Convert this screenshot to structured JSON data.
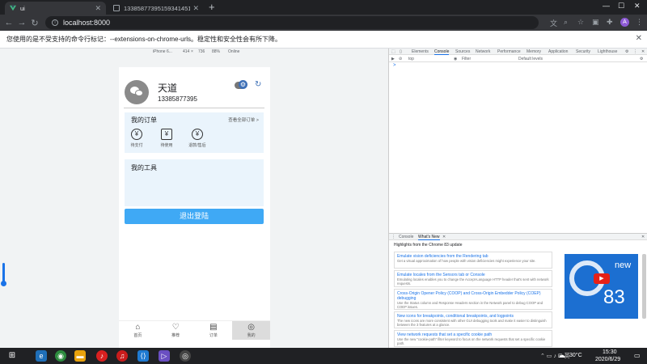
{
  "browser": {
    "tabs": [
      {
        "title": "ui",
        "active": true
      },
      {
        "title": "13385877395159341451856...",
        "active": false
      }
    ],
    "new_tab": "+",
    "url": "localhost:8000",
    "profile_initial": "A",
    "infobar_text": "您使用的是不受支持的命令行标记：--extensions-on-chrome-urls。稳定性和安全性会有所下降。"
  },
  "device_toolbar": {
    "device": "iPhone 6...",
    "width": "414",
    "height": "736",
    "zoom": "88%",
    "network": "Online"
  },
  "app": {
    "user": {
      "name": "天道",
      "phone": "13385877395"
    },
    "orders": {
      "title": "我的订单",
      "view_all": "查看全部订单 >",
      "items": [
        {
          "label": "待支付",
          "icon": "yen-icon"
        },
        {
          "label": "待使用",
          "icon": "ticket-icon"
        },
        {
          "label": "退款/售后",
          "icon": "refund-icon"
        }
      ]
    },
    "tools": {
      "title": "我的工具"
    },
    "logout_label": "退出登陆",
    "tabbar": [
      {
        "label": "首页",
        "icon": "home-icon"
      },
      {
        "label": "推荐",
        "icon": "heart-icon"
      },
      {
        "label": "订单",
        "icon": "list-icon"
      },
      {
        "label": "我的",
        "icon": "user-icon"
      }
    ]
  },
  "devtools": {
    "tabs": [
      "Elements",
      "Console",
      "Sources",
      "Network",
      "Performance",
      "Memory",
      "Application",
      "Security",
      "Lighthouse"
    ],
    "active_tab": "Console",
    "context": "top",
    "filter_placeholder": "Filter",
    "levels": "Default levels",
    "prompt": ">",
    "drawer_tabs": [
      "Console",
      "What's New"
    ],
    "drawer_active": "What's New",
    "highlights_title": "Highlights from the Chrome 83 update",
    "news": [
      {
        "title": "Emulate vision deficiencies from the Rendering tab",
        "desc": "Get a visual approximation of how people with vision deficiencies might experience your site."
      },
      {
        "title": "Emulate locales from the Sensors tab or Console",
        "desc": "Emulating locales enables you to change the Accept-Language HTTP header that's sent with network requests."
      },
      {
        "title": "Cross-Origin Opener Policy (COOP) and Cross-Origin Embedder Policy (COEP) debugging",
        "desc": "Use the Status column and Response Headers section in the Network panel to debug COOP and COEP issues."
      },
      {
        "title": "New icons for breakpoints, conditional breakpoints, and logpoints",
        "desc": "The new icons are more consistent with other GUI debugging tools and make it easier to distinguish between the 3 features at a glance."
      },
      {
        "title": "View network requests that set a specific cookie path",
        "desc": "Use the new \"cookie-path\" filter keyword to focus on the network requests that set a specific cookie path."
      }
    ],
    "promo_new": "new",
    "promo_version": "83"
  },
  "taskbar": {
    "temperature": "30°C",
    "time": "15:30",
    "date": "2020/6/29"
  },
  "colors": {
    "accent": "#3fa9f5",
    "panel": "#eaf4fc",
    "chrome_dark": "#202124"
  }
}
